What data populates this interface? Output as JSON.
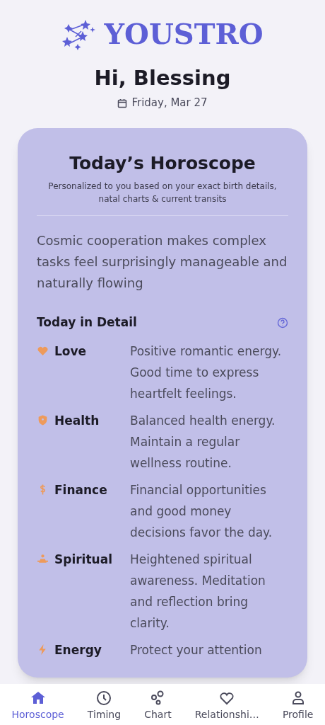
{
  "app": {
    "logo_text": "YOUSTRO"
  },
  "greeting": "Hi, Blessing",
  "date": "Friday, Mar 27",
  "card": {
    "title": "Today’s Horoscope",
    "subtitle": "Personalized to you based on your exact birth details, natal charts & current transits",
    "summary": "Cosmic cooperation makes complex tasks feel surprisingly manageable and naturally flowing",
    "detail_heading": "Today in Detail",
    "details": [
      {
        "kind": "love",
        "label": "Love",
        "text": "Positive romantic energy. Good time to express heartfelt feelings."
      },
      {
        "kind": "health",
        "label": "Health",
        "text": "Balanced health energy. Maintain a regular wellness routine."
      },
      {
        "kind": "finance",
        "label": "Finance",
        "text": "Financial opportunities and good money decisions favor the day."
      },
      {
        "kind": "spiritual",
        "label": "Spiritual",
        "text": "Heightened spiritual awareness. Meditation and reflection bring clarity."
      },
      {
        "kind": "energy",
        "label": "Energy",
        "text": "Protect your attention"
      }
    ]
  },
  "nav": [
    {
      "kind": "home",
      "label": "Horoscope",
      "selected": true
    },
    {
      "kind": "clock",
      "label": "Timing",
      "selected": false
    },
    {
      "kind": "chart",
      "label": "Chart",
      "selected": false
    },
    {
      "kind": "heart",
      "label": "Relationshi…",
      "selected": false
    },
    {
      "kind": "person",
      "label": "Profile",
      "selected": false
    }
  ]
}
